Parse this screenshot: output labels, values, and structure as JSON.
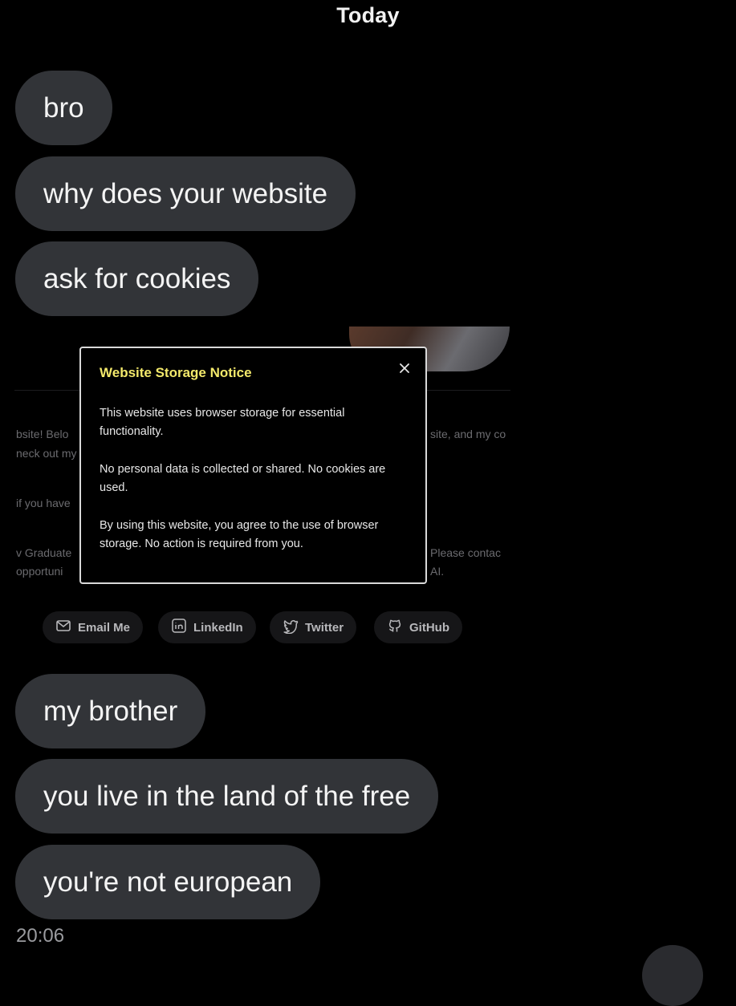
{
  "chat": {
    "date_header": "Today",
    "messages_top": [
      "bro",
      "why does your website",
      "ask for cookies"
    ],
    "messages_bottom": [
      "my brother",
      "you live in the land of the free",
      "you're not european"
    ],
    "timestamp": "20:06"
  },
  "website": {
    "background_left": [
      "bsite! Belo",
      "neck out my",
      "if you have",
      "v Graduate",
      "opportuni"
    ],
    "background_right": [
      "site, and my co",
      "Please contac",
      "AI."
    ],
    "social_buttons": [
      {
        "label": "Email Me",
        "icon": "mail-icon"
      },
      {
        "label": "LinkedIn",
        "icon": "linkedin-icon"
      },
      {
        "label": "Twitter",
        "icon": "twitter-icon"
      },
      {
        "label": "GitHub",
        "icon": "github-icon"
      }
    ]
  },
  "modal": {
    "title": "Website Storage Notice",
    "paragraphs": [
      "This website uses browser storage for essential functionality.",
      "No personal data is collected or shared. No cookies are used.",
      "By using this website, you agree to the use of browser storage. No action is required from you."
    ],
    "close_icon": "close-icon"
  },
  "colors": {
    "bubble": "#323438",
    "modal_title": "#f3e96b",
    "background": "#000000"
  }
}
